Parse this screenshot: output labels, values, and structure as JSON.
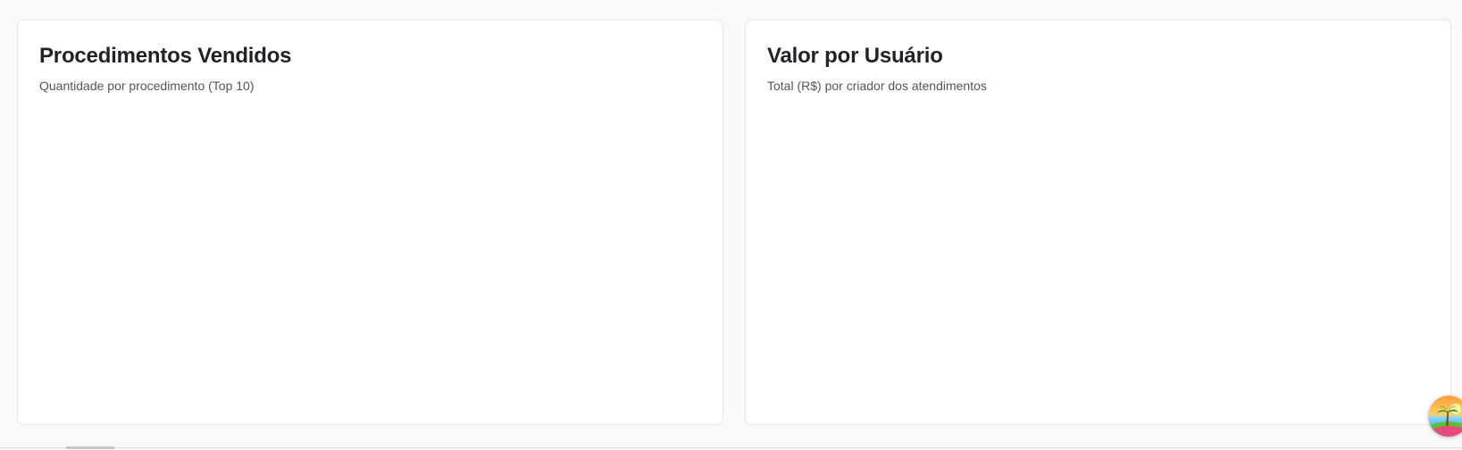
{
  "cards": [
    {
      "title": "Procedimentos Vendidos",
      "subtitle": "Quantidade por procedimento (Top 10)"
    },
    {
      "title": "Valor por Usuário",
      "subtitle": "Total (R$) por criador dos atendimentos"
    }
  ],
  "widget": {
    "icon": "island-palm-icon"
  },
  "colors": {
    "background": "#f8f9fb",
    "card": "#ffffff",
    "border": "#e4e6ea",
    "title": "#1f2328",
    "subtitle": "#50555c"
  }
}
